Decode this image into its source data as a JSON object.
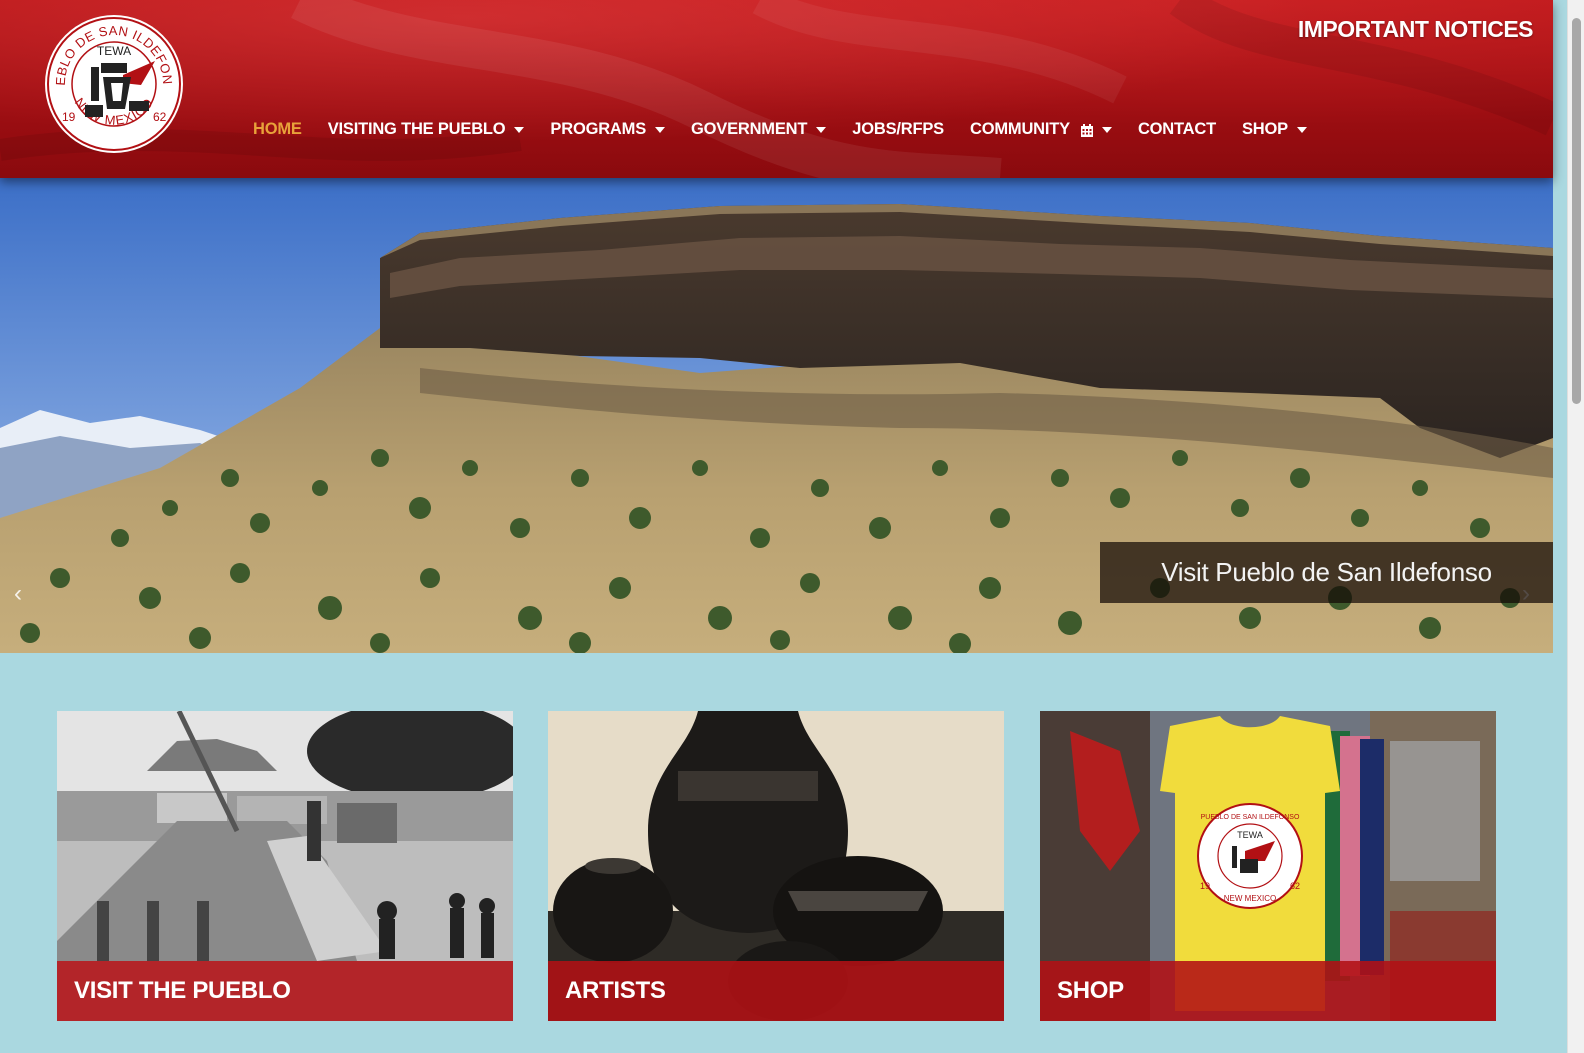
{
  "header": {
    "logo": {
      "ring_text_top": "PUEBLO DE SAN ILDEFONSO",
      "center_text": "TEWA",
      "ring_text_bottom": "NEW MEXICO",
      "year_left": "19",
      "year_right": "62"
    },
    "notices_label": "IMPORTANT NOTICES",
    "nav": [
      {
        "label": "HOME",
        "active": true,
        "dropdown": false
      },
      {
        "label": "VISITING THE PUEBLO",
        "dropdown": true
      },
      {
        "label": "PROGRAMS",
        "dropdown": true
      },
      {
        "label": "GOVERNMENT",
        "dropdown": true
      },
      {
        "label": "JOBS/RFPS",
        "dropdown": false
      },
      {
        "label": "COMMUNITY",
        "dropdown": true,
        "icon": "calendar-icon"
      },
      {
        "label": "CONTACT",
        "dropdown": false
      },
      {
        "label": "SHOP",
        "dropdown": true
      }
    ],
    "colors": {
      "header_red": "#a50f13",
      "active_nav": "#e8a23a"
    }
  },
  "hero": {
    "caption": "Visit Pueblo de San Ildefonso",
    "prev_icon": "chevron-left-icon",
    "next_icon": "chevron-right-icon"
  },
  "cards": [
    {
      "label": "VISIT THE PUEBLO"
    },
    {
      "label": "ARTISTS"
    },
    {
      "label": "SHOP"
    }
  ],
  "tshirt_logo": {
    "ring_text_top": "PUEBLO DE SAN ILDEFONSO",
    "center_text": "TEWA",
    "ring_text_bottom": "NEW MEXICO",
    "year_left": "19",
    "year_right": "62"
  },
  "colors": {
    "page_bg": "#aad8e0",
    "card_label_bg": "#b21014"
  }
}
